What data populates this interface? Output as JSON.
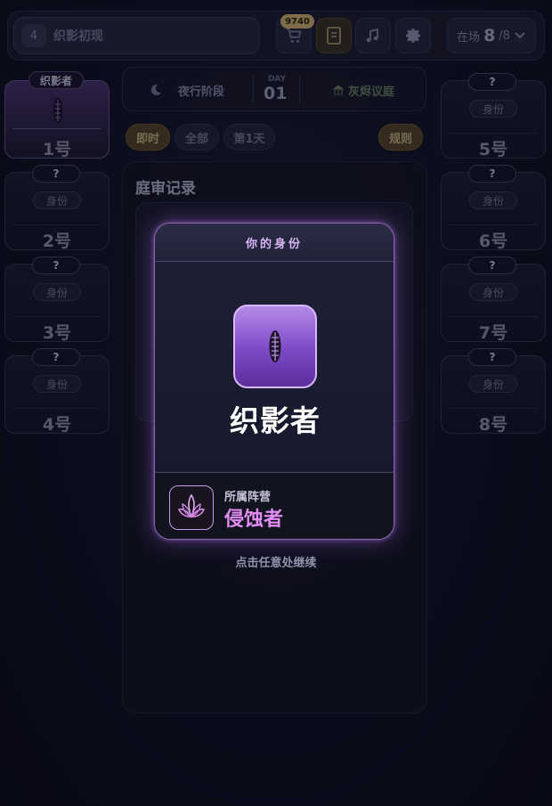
{
  "topbar": {
    "level": "4",
    "room_name": "织影初现",
    "coins": "9740",
    "cart_icon": "cart-icon",
    "book_icon": "book-icon",
    "music_icon": "music-icon",
    "settings_icon": "gear-icon",
    "online_label": "在场",
    "online_count": "8",
    "online_total": "/8"
  },
  "seats_left": [
    {
      "tag": "织影者",
      "number": "1号",
      "self": true
    },
    {
      "tag": "?",
      "role": "身份",
      "number": "2号"
    },
    {
      "tag": "?",
      "role": "身份",
      "number": "3号"
    },
    {
      "tag": "?",
      "role": "身份",
      "number": "4号"
    }
  ],
  "seats_right": [
    {
      "tag": "?",
      "role": "身份",
      "number": "5号"
    },
    {
      "tag": "?",
      "role": "身份",
      "number": "6号"
    },
    {
      "tag": "?",
      "role": "身份",
      "number": "7号"
    },
    {
      "tag": "?",
      "role": "身份",
      "number": "8号"
    }
  ],
  "phase": {
    "phase_name": "夜行阶段",
    "day_label": "DAY",
    "day_number": "01",
    "court_name": "灰烬议庭"
  },
  "filters": {
    "instant": "即时",
    "all": "全部",
    "day1": "第1天",
    "rules": "规则"
  },
  "log": {
    "title": "庭审记录"
  },
  "modal": {
    "header": "你的身份",
    "role_name": "织影者",
    "faction_label": "所属阵营",
    "faction_name": "侵蚀者",
    "continue_hint": "点击任意处继续"
  },
  "colors": {
    "accent_purple": "#a974e3",
    "faction_pink": "#e28cf4",
    "gold": "#d8c08a"
  }
}
